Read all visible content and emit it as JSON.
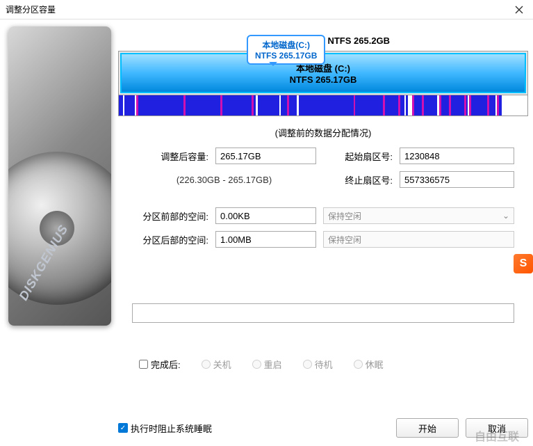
{
  "window": {
    "title": "调整分区容量"
  },
  "tooltip": {
    "line1": "本地磁盘(C:)",
    "line2": "NTFS 265.17GB"
  },
  "disk_header": "D1:本地磁盘 (C:) NTFS 265.2GB",
  "partition": {
    "name": "本地磁盘 (C:)",
    "info": "NTFS 265.17GB"
  },
  "section_title": "(调整前的数据分配情况)",
  "form": {
    "size_label": "调整后容量:",
    "size_value": "265.17GB",
    "range_hint": "(226.30GB - 265.17GB)",
    "start_label": "起始扇区号:",
    "start_value": "1230848",
    "end_label": "终止扇区号:",
    "end_value": "557336575",
    "before_label": "分区前部的空间:",
    "before_value": "0.00KB",
    "before_mode": "保持空闲",
    "after_label": "分区后部的空间:",
    "after_value": "1.00MB",
    "after_mode": "保持空闲"
  },
  "after_complete": {
    "checkbox_label": "完成后:",
    "options": [
      "关机",
      "重启",
      "待机",
      "休眠"
    ]
  },
  "bottom": {
    "prevent_sleep": "执行时阻止系统睡眠",
    "start": "开始",
    "cancel": "取消"
  },
  "hdd_brand": "DISKGENIUS",
  "watermark": "自由互联"
}
